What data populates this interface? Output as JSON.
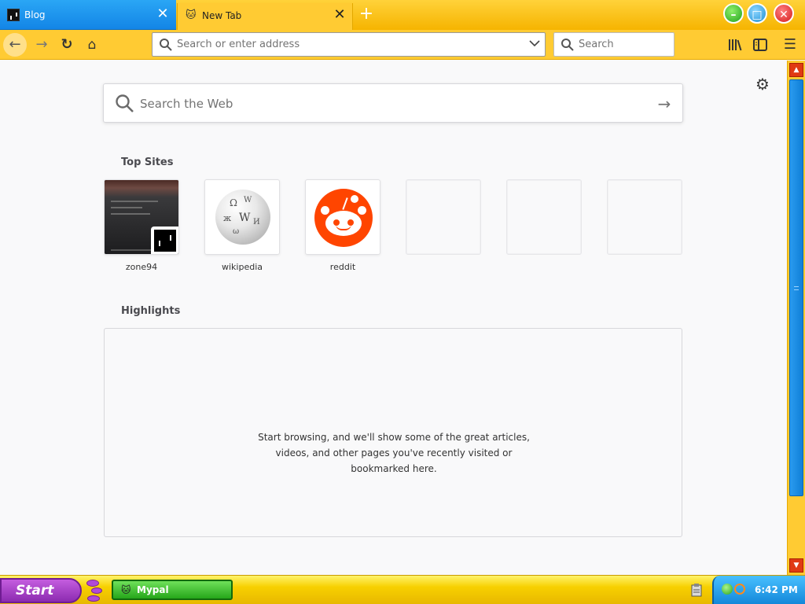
{
  "tabs": {
    "inactive": {
      "label": "Blog",
      "icon": "pong-favicon-icon"
    },
    "active": {
      "label": "New Tab",
      "icon": "mypal-favicon-icon"
    },
    "close_glyph": "✕",
    "new_tab_glyph": "+"
  },
  "window_controls": {
    "minimize": "minimize-icon",
    "maximize": "maximize-icon",
    "close": "close-icon"
  },
  "toolbar": {
    "url_placeholder": "Search or enter address",
    "search_placeholder": "Search"
  },
  "newtab": {
    "web_search_placeholder": "Search the Web",
    "top_sites_title": "Top Sites",
    "top_sites": [
      {
        "label": "zone94"
      },
      {
        "label": "wikipedia"
      },
      {
        "label": "reddit"
      }
    ],
    "highlights_title": "Highlights",
    "highlights_message": "Start browsing, and we'll show some of the great articles, videos, and other pages you've recently visited or bookmarked here."
  },
  "taskbar": {
    "start_label": "Start",
    "app_label": "Mypal",
    "clock": "6:42 PM"
  },
  "colors": {
    "toolbar_yellow": "#ffcb33",
    "tab_blue": "#1a8ef0",
    "scroll_red": "#e03a13",
    "start_purple": "#a040c8",
    "app_green": "#3cc22c"
  }
}
